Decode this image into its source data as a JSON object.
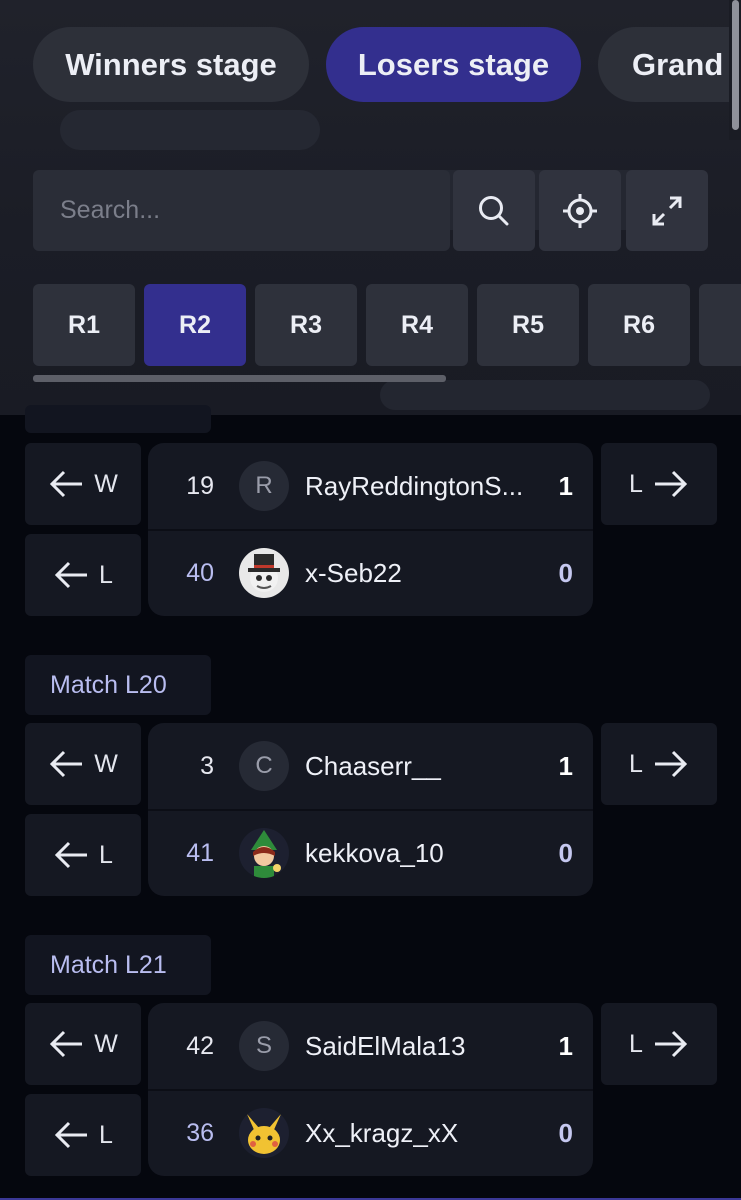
{
  "stage_tabs": [
    {
      "label": "Winners stage",
      "active": false
    },
    {
      "label": "Losers stage",
      "active": true
    },
    {
      "label": "Grand final",
      "active": false
    }
  ],
  "search": {
    "placeholder": "Search...",
    "value": ""
  },
  "toolbar": {
    "search_icon": "search-icon",
    "locate_icon": "crosshair-icon",
    "expand_icon": "expand-icon"
  },
  "rounds": [
    {
      "label": "R1",
      "active": false
    },
    {
      "label": "R2",
      "active": true
    },
    {
      "label": "R3",
      "active": false
    },
    {
      "label": "R4",
      "active": false
    },
    {
      "label": "R5",
      "active": false
    },
    {
      "label": "R6",
      "active": false
    }
  ],
  "nav": {
    "winner_label": "W",
    "loser_label": "L"
  },
  "matches": [
    {
      "label": "",
      "players": [
        {
          "seed": "19",
          "avatar": "R",
          "name": "RayReddingtonS...",
          "score": "1"
        },
        {
          "seed": "40",
          "avatar": "top-hat-avatar",
          "name": "x-Seb22",
          "score": "0"
        }
      ]
    },
    {
      "label": "Match L20",
      "players": [
        {
          "seed": "3",
          "avatar": "C",
          "name": "Chaaserr__",
          "score": "1"
        },
        {
          "seed": "41",
          "avatar": "elf-avatar",
          "name": "kekkova_10",
          "score": "0"
        }
      ]
    },
    {
      "label": "Match L21",
      "players": [
        {
          "seed": "42",
          "avatar": "S",
          "name": "SaidElMala13",
          "score": "1"
        },
        {
          "seed": "36",
          "avatar": "pikachu-avatar",
          "name": "Xx_kragz_xX",
          "score": "0"
        }
      ]
    }
  ],
  "colors": {
    "accent": "#332f8e",
    "background": "#05070e",
    "card": "#151822"
  }
}
